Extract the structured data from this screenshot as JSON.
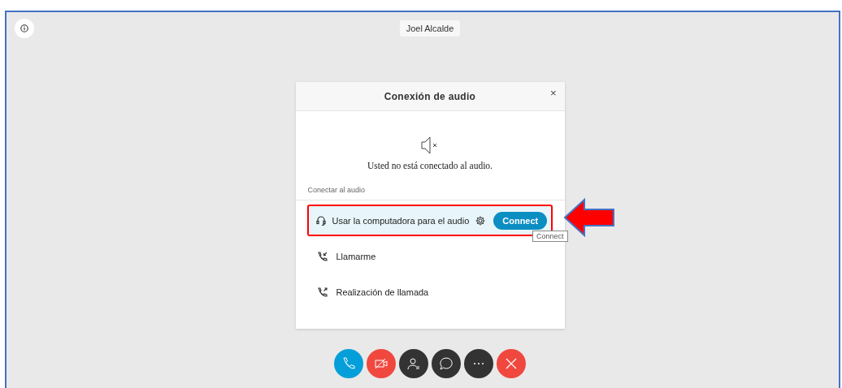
{
  "participant": {
    "name": "Joel Alcalde"
  },
  "dialog": {
    "title": "Conexión de audio",
    "close": "×",
    "status": "Usted no está conectado al audio.",
    "section_label": "Conectar al audio",
    "options": [
      {
        "kind": "computer",
        "label": "Usar la computadora para el audio",
        "selected": true,
        "button": "Connect",
        "tooltip": "Connect"
      },
      {
        "kind": "callme",
        "label": "Llamarme",
        "selected": false
      },
      {
        "kind": "callin",
        "label": "Realización de llamada",
        "selected": false
      }
    ]
  },
  "controls": [
    {
      "kind": "phone",
      "color": "#049fd9"
    },
    {
      "kind": "video",
      "color": "#f0483e"
    },
    {
      "kind": "participants",
      "color": "#333333"
    },
    {
      "kind": "chat",
      "color": "#333333"
    },
    {
      "kind": "more",
      "color": "#333333"
    },
    {
      "kind": "leave",
      "color": "#f0483e"
    }
  ]
}
